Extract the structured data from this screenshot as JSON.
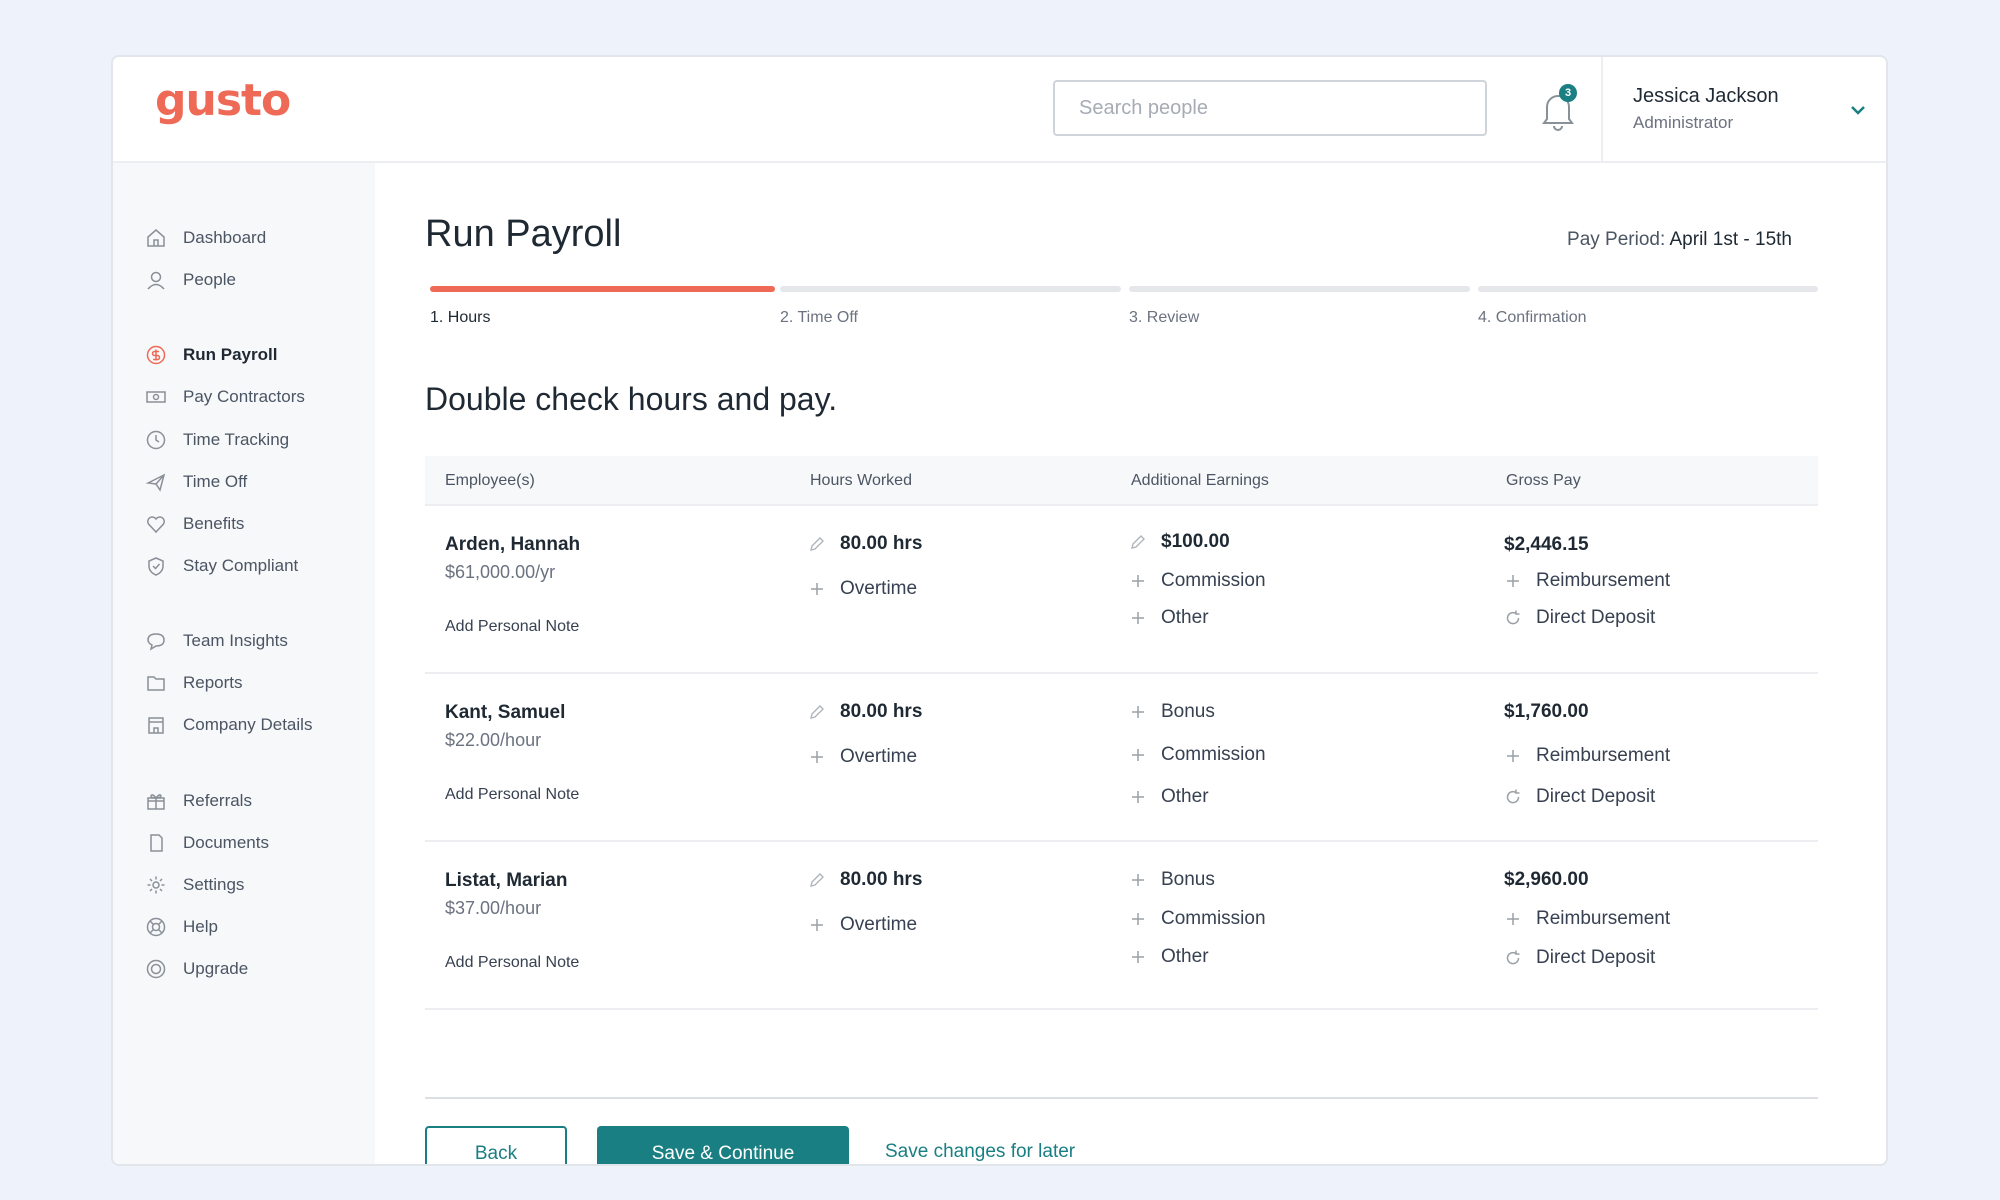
{
  "app": {
    "logo": "gusto"
  },
  "header": {
    "search_placeholder": "Search people",
    "notification_count": "3",
    "user_name": "Jessica Jackson",
    "user_role": "Administrator"
  },
  "sidebar": {
    "items": [
      {
        "label": "Dashboard",
        "icon": "home-icon"
      },
      {
        "label": "People",
        "icon": "person-icon"
      },
      {
        "label": "Run Payroll",
        "icon": "dollar-icon",
        "active": true
      },
      {
        "label": "Pay Contractors",
        "icon": "cash-icon"
      },
      {
        "label": "Time Tracking",
        "icon": "clock-icon"
      },
      {
        "label": "Time Off",
        "icon": "plane-icon"
      },
      {
        "label": "Benefits",
        "icon": "heart-icon"
      },
      {
        "label": "Stay Compliant",
        "icon": "shield-icon"
      },
      {
        "label": "Team Insights",
        "icon": "chat-icon"
      },
      {
        "label": "Reports",
        "icon": "folder-icon"
      },
      {
        "label": "Company Details",
        "icon": "building-icon"
      },
      {
        "label": "Referrals",
        "icon": "gift-icon"
      },
      {
        "label": "Documents",
        "icon": "document-icon"
      },
      {
        "label": "Settings",
        "icon": "gear-icon"
      },
      {
        "label": "Help",
        "icon": "lifebuoy-icon"
      },
      {
        "label": "Upgrade",
        "icon": "upgrade-icon"
      }
    ]
  },
  "main": {
    "title": "Run Payroll",
    "pay_period_label": "Pay Period:",
    "pay_period_value": "April 1st - 15th",
    "steps": [
      "1. Hours",
      "2. Time Off",
      "3. Review",
      "4. Confirmation"
    ],
    "active_step": 1,
    "subtitle": "Double check hours and pay.",
    "columns": [
      "Employee(s)",
      "Hours Worked",
      "Additional Earnings",
      "Gross Pay"
    ],
    "rows": [
      {
        "name": "Arden, Hannah",
        "rate": "$61,000.00/yr",
        "note": "Add Personal Note",
        "hours": "80.00 hrs",
        "overtime": "Overtime",
        "earnings": [
          "$100.00",
          "Commission",
          "Other"
        ],
        "gross": "$2,446.15",
        "reimbursement": "Reimbursement",
        "deposit": "Direct Deposit"
      },
      {
        "name": "Kant, Samuel",
        "rate": "$22.00/hour",
        "note": "Add Personal Note",
        "hours": "80.00 hrs",
        "overtime": "Overtime",
        "earnings": [
          "Bonus",
          "Commission",
          "Other"
        ],
        "gross": "$1,760.00",
        "reimbursement": "Reimbursement",
        "deposit": "Direct Deposit"
      },
      {
        "name": "Listat, Marian",
        "rate": "$37.00/hour",
        "note": "Add Personal Note",
        "hours": "80.00 hrs",
        "overtime": "Overtime",
        "earnings": [
          "Bonus",
          "Commission",
          "Other"
        ],
        "gross": "$2,960.00",
        "reimbursement": "Reimbursement",
        "deposit": "Direct Deposit"
      }
    ],
    "buttons": {
      "back": "Back",
      "save": "Save & Continue",
      "later": "Save changes for later"
    }
  },
  "colors": {
    "brand": "#ef6a56",
    "accent": "#1a7f82"
  }
}
